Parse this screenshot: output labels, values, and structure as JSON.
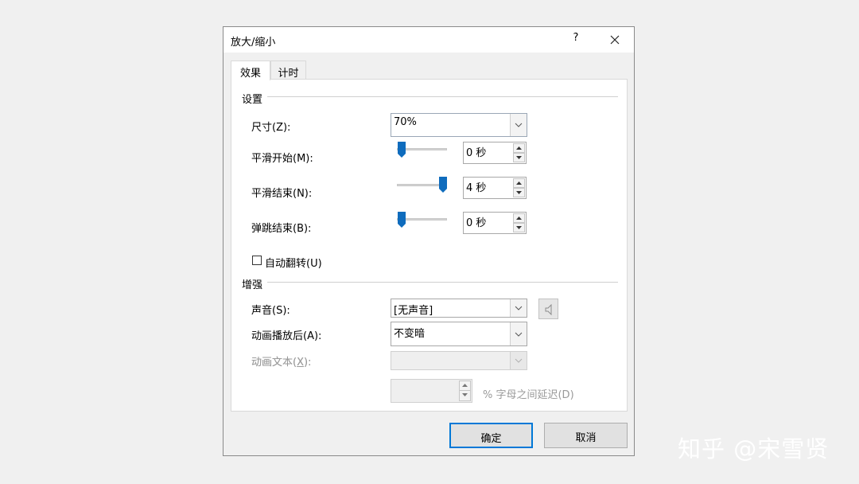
{
  "dialog": {
    "title": "放大/缩小",
    "help": "?"
  },
  "tabs": [
    {
      "label": "效果",
      "selected": true
    },
    {
      "label": "计时",
      "selected": false
    }
  ],
  "settings": {
    "group_label": "设置",
    "size": {
      "label": "尺寸(Z):",
      "value": "70%"
    },
    "smooth_start": {
      "label": "平滑开始(M):",
      "value": "0 秒",
      "slider_fraction": 0.0
    },
    "smooth_end": {
      "label": "平滑结束(N):",
      "value": "4 秒",
      "slider_fraction": 1.0
    },
    "bounce_end": {
      "label": "弹跳结束(B):",
      "value": "0 秒",
      "slider_fraction": 0.0
    },
    "auto_reverse": {
      "label": "自动翻转(U)",
      "checked": false
    }
  },
  "enhancements": {
    "group_label": "增强",
    "sound": {
      "label": "声音(S):",
      "value": "[无声音]"
    },
    "after_animation": {
      "label": "动画播放后(A):",
      "value": "不变暗"
    },
    "animate_text": {
      "label": "动画文本(X):",
      "value": "",
      "disabled": true
    },
    "letter_delay": {
      "value": "",
      "label": "% 字母之间延迟(D)",
      "disabled": true
    }
  },
  "buttons": {
    "ok": "确定",
    "cancel": "取消"
  },
  "watermark": "知乎 @宋雪贤",
  "colors": {
    "accent": "#0078d7",
    "slider_thumb": "#0f6cbd"
  }
}
